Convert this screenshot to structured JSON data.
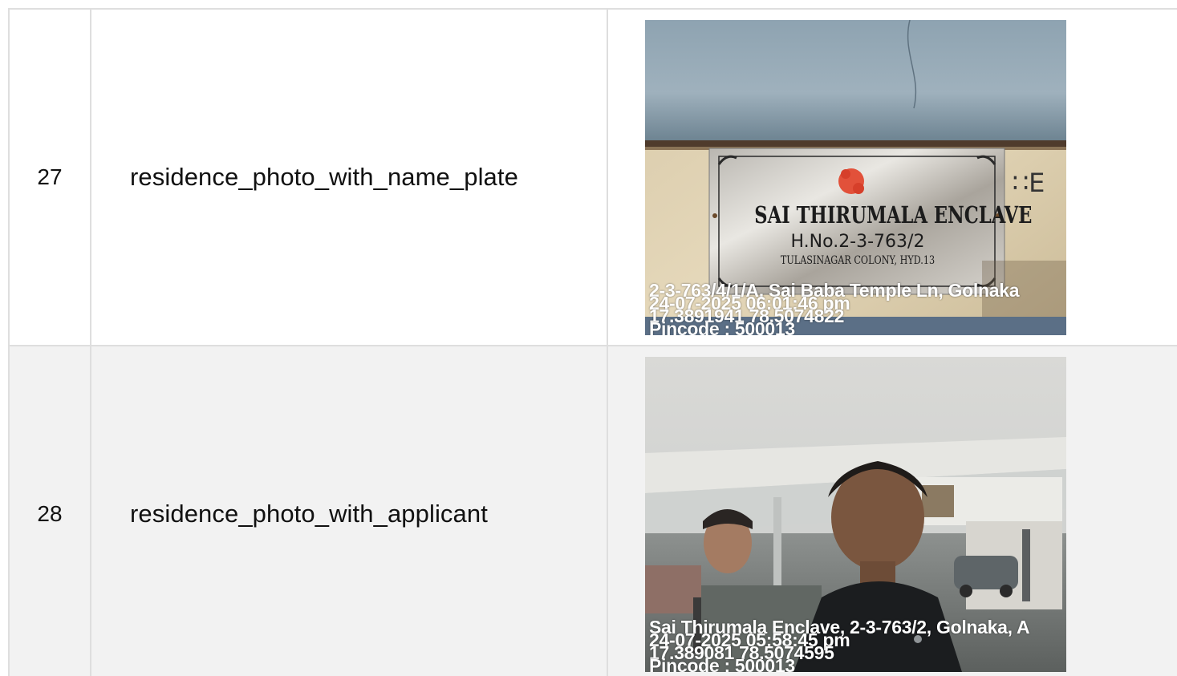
{
  "rows": [
    {
      "number": "27",
      "field": "residence_photo_with_name_plate",
      "photo": {
        "plate": {
          "title": "SAI THIRUMALA ENCLAVE",
          "house_no": "H.No.2-3-763/2",
          "colony": "TULASINAGAR COLONY, HYD.13"
        },
        "wall_mark": "∷E",
        "stamp": {
          "address": "2-3-763/4/1/A, Sai Baba Temple Ln, Golnaka",
          "datetime": "24-07-2025 06:01:46 pm",
          "coords": "17.3891941 78.5074822",
          "pincode": "Pincode : 500013"
        }
      }
    },
    {
      "number": "28",
      "field": "residence_photo_with_applicant",
      "photo": {
        "stamp": {
          "address": "Sai Thirumala Enclave, 2-3-763/2, Golnaka, A",
          "datetime": "24-07-2025 05:58:45 pm",
          "coords": "17.389081 78.5074595",
          "pincode": "Pincode : 500013"
        }
      }
    }
  ],
  "colors": {
    "border": "#dedede",
    "row_alt_bg": "#f2f2f2",
    "text": "#111111"
  }
}
